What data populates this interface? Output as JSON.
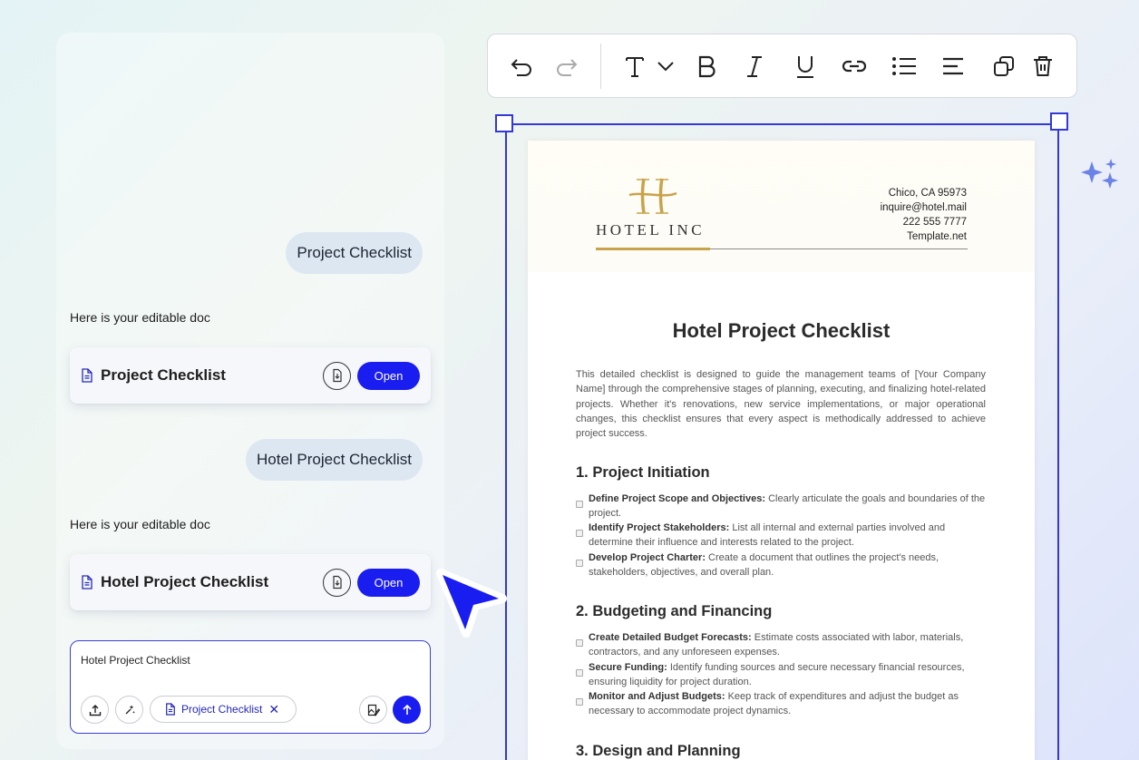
{
  "chat": {
    "messages": [
      {
        "role": "user",
        "text": "Project Checklist"
      },
      {
        "role": "assistant",
        "text": "Here is your editable doc",
        "doc_title": "Project Checklist",
        "open_label": "Open"
      },
      {
        "role": "user",
        "text": "Hotel Project Checklist"
      },
      {
        "role": "assistant",
        "text": "Here is your editable doc",
        "doc_title": "Hotel Project Checklist",
        "open_label": "Open"
      }
    ],
    "input": {
      "value": "Hotel Project Checklist",
      "chip_label": "Project Checklist",
      "icons": [
        "upload-icon",
        "sparkle-wand-icon",
        "document-icon",
        "close-icon",
        "image-edit-icon",
        "arrow-up-icon"
      ]
    }
  },
  "toolbar": {
    "icons": [
      "undo-icon",
      "redo-icon",
      "text-format-icon",
      "chevron-down-icon",
      "bold-icon",
      "italic-icon",
      "underline-icon",
      "link-icon",
      "bullet-list-icon",
      "align-left-icon",
      "duplicate-icon",
      "delete-icon"
    ]
  },
  "document": {
    "logo_letter": "H",
    "company": "HOTEL INC",
    "contact": [
      "Chico, CA 95973",
      "inquire@hotel.mail",
      "222 555 7777",
      "Template.net"
    ],
    "title": "Hotel Project Checklist",
    "intro": "This detailed checklist is designed to guide the management teams of [Your Company Name] through the comprehensive stages of planning, executing, and finalizing hotel-related projects. Whether it's renovations, new service implementations, or major operational changes, this checklist ensures that every aspect is methodically addressed to achieve project success.",
    "sections": [
      {
        "heading": "1. Project Initiation",
        "items": [
          {
            "label": "Define Project Scope and Objectives:",
            "text": " Clearly articulate the goals and boundaries of the project."
          },
          {
            "label": "Identify Project Stakeholders:",
            "text": " List all internal and external parties involved and determine their influence and interests related to the project."
          },
          {
            "label": "Develop Project Charter:",
            "text": " Create a document that outlines the project's needs, stakeholders, objectives, and overall plan."
          }
        ]
      },
      {
        "heading": "2. Budgeting and Financing",
        "items": [
          {
            "label": "Create Detailed Budget Forecasts:",
            "text": " Estimate costs associated with labor, materials, contractors, and any unforeseen expenses."
          },
          {
            "label": "Secure Funding:",
            "text": " Identify funding sources and secure necessary financial resources, ensuring liquidity for project duration."
          },
          {
            "label": "Monitor and Adjust Budgets:",
            "text": " Keep track of expenditures and adjust the budget as necessary to accommodate project dynamics."
          }
        ]
      },
      {
        "heading": "3. Design and Planning",
        "items": []
      }
    ]
  },
  "colors": {
    "accent": "#1a1df0",
    "selection": "#3438d6",
    "gold": "#c9a34a",
    "user_bubble": "#dde7f2"
  }
}
